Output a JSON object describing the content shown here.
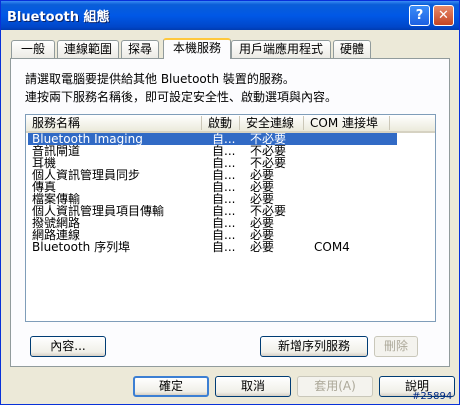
{
  "window": {
    "title": "Bluetooth 組態"
  },
  "tabs": [
    {
      "label": "一般"
    },
    {
      "label": "連線範圍"
    },
    {
      "label": "探尋"
    },
    {
      "label": "本機服務"
    },
    {
      "label": "用戶端應用程式"
    },
    {
      "label": "硬體"
    }
  ],
  "active_tab": "本機服務",
  "panel": {
    "description_line1": "請選取電腦要提供給其他 Bluetooth 裝置的服務。",
    "description_line2": "連按兩下服務名稱後，即可設定安全性、啟動選項與內容。"
  },
  "list": {
    "columns": [
      "服務名稱",
      "啟動",
      "安全連線",
      "COM 連接埠"
    ],
    "rows": [
      {
        "name": "Bluetooth Imaging",
        "startup": "自...",
        "secure": "不必要",
        "com": "",
        "selected": true
      },
      {
        "name": "音訊閘道",
        "startup": "自...",
        "secure": "不必要",
        "com": ""
      },
      {
        "name": "耳機",
        "startup": "自...",
        "secure": "不必要",
        "com": ""
      },
      {
        "name": "個人資訊管理員同步",
        "startup": "自...",
        "secure": "必要",
        "com": ""
      },
      {
        "name": "傳真",
        "startup": "自...",
        "secure": "必要",
        "com": ""
      },
      {
        "name": "檔案傳輸",
        "startup": "自...",
        "secure": "必要",
        "com": ""
      },
      {
        "name": "個人資訊管理員項目傳輸",
        "startup": "自...",
        "secure": "不必要",
        "com": ""
      },
      {
        "name": "撥號網路",
        "startup": "自...",
        "secure": "必要",
        "com": ""
      },
      {
        "name": "網路連線",
        "startup": "自...",
        "secure": "必要",
        "com": ""
      },
      {
        "name": "Bluetooth 序列埠",
        "startup": "自...",
        "secure": "必要",
        "com": "COM4"
      }
    ]
  },
  "panel_buttons": {
    "properties": "內容...",
    "add_serial": "新增序列服務",
    "delete": "刪除"
  },
  "dialog_buttons": {
    "ok": "確定",
    "cancel": "取消",
    "apply": "套用(A)",
    "help": "說明"
  },
  "watermark": "#25894"
}
